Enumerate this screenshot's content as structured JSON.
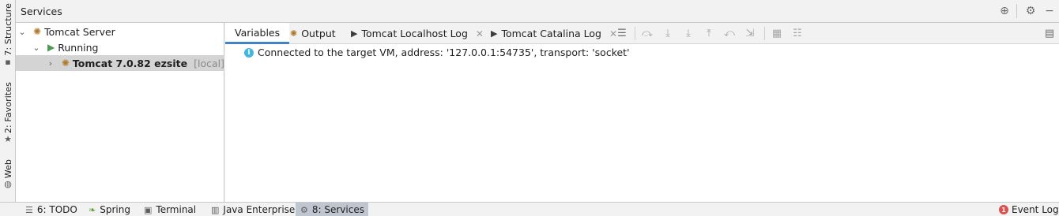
{
  "left_stripe": {
    "tabs": [
      {
        "label": "7: Structure",
        "icon": "structure-icon"
      },
      {
        "label": "2: Favorites",
        "icon": "star-icon"
      },
      {
        "label": "Web",
        "icon": "globe-icon"
      }
    ]
  },
  "services": {
    "title": "Services",
    "header_icons": [
      "crosshair-icon",
      "gear-icon",
      "minimize-icon"
    ]
  },
  "tree": {
    "server": "Tomcat Server",
    "status": "Running",
    "instance_name": "Tomcat 7.0.82 ezsite",
    "instance_tag": "[local]"
  },
  "tabs": [
    {
      "label": "Variables",
      "active": true
    },
    {
      "label": "Output",
      "icon": "tomcat-icon"
    },
    {
      "label": "Tomcat Localhost Log",
      "icon": "log-icon",
      "closable": true
    },
    {
      "label": "Tomcat Catalina Log",
      "icon": "log-icon",
      "closable": true
    }
  ],
  "toolbar_icons": [
    "menu-icon",
    "step-over-icon",
    "step-into-icon",
    "force-step-into-icon",
    "step-out-icon",
    "drop-frame-icon",
    "run-to-cursor-icon",
    "evaluate-icon",
    "trace-icon",
    "layout-icon"
  ],
  "console": {
    "message": "Connected to the target VM, address: '127.0.0.1:54735', transport: 'socket'"
  },
  "bottom_bar": {
    "tabs": [
      {
        "label": "6: TODO",
        "icon": "list-icon"
      },
      {
        "label": "Spring",
        "icon": "spring-leaf-icon"
      },
      {
        "label": "Terminal",
        "icon": "terminal-icon"
      },
      {
        "label": "Java Enterprise",
        "icon": "java-ee-icon"
      },
      {
        "label": "8: Services",
        "icon": "services-icon",
        "active": true
      }
    ],
    "event_log": {
      "label": "Event Log",
      "count": "1"
    }
  },
  "colors": {
    "accent": "#4083c9",
    "running": "#499c54",
    "info": "#40b6e0",
    "error": "#d9534f"
  }
}
